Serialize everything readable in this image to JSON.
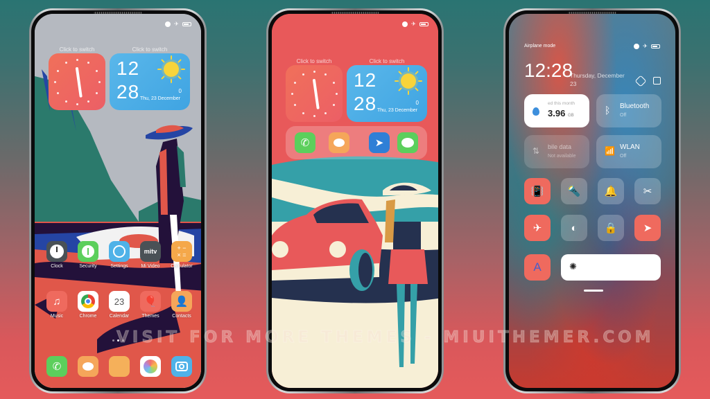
{
  "colors": {
    "accent_red": "#ec5f5c",
    "weather_blue": "#4aaee6",
    "clock_red": "#ef6a5e",
    "bg_teal": "#2a7472",
    "bg_red": "#e55a5b"
  },
  "status_bar": {
    "icons": [
      "alarm-icon",
      "airplane-icon",
      "battery-icon"
    ]
  },
  "widgets": {
    "clock_switch_label": "Click to switch",
    "weather_switch_label": "Click to switch",
    "weather": {
      "hour": "12",
      "minute": "28",
      "date": "Thu, 23 December",
      "temperature": "0",
      "condition_icon": "sun-icon"
    }
  },
  "phone1": {
    "apps_row1": [
      {
        "label": "Clock",
        "icon": "clock-icon",
        "color": "#4a5156"
      },
      {
        "label": "Security",
        "icon": "security-icon",
        "color": "#5ccf5c"
      },
      {
        "label": "Settings",
        "icon": "settings-icon",
        "color": "#4fb2e8"
      },
      {
        "label": "Mi Video",
        "icon": "mitv-icon",
        "color": "#4a5156",
        "glyph": "mitv"
      },
      {
        "label": "Calculator",
        "icon": "calculator-icon",
        "color": "#f5a84a"
      }
    ],
    "apps_row2": [
      {
        "label": "Music",
        "icon": "music-icon",
        "color": "#ef6a5e"
      },
      {
        "label": "Chrome",
        "icon": "chrome-icon",
        "color": "#ffffff"
      },
      {
        "label": "Calendar",
        "icon": "calendar-icon",
        "color": "#ffffff",
        "glyph": "23"
      },
      {
        "label": "Themes",
        "icon": "themes-icon",
        "color": "#ef6a5e"
      },
      {
        "label": "Contacts",
        "icon": "contacts-icon",
        "color": "#f5a65a"
      }
    ],
    "dock": [
      {
        "name": "phone",
        "icon": "phone-icon",
        "color": "#5ccf5c"
      },
      {
        "name": "messages",
        "icon": "messages-icon",
        "color": "#f5a65a"
      },
      {
        "name": "notes",
        "icon": "notes-icon",
        "color": "#f5b05a"
      },
      {
        "name": "gallery",
        "icon": "gallery-icon",
        "color": "#ffffff"
      },
      {
        "name": "camera",
        "icon": "camera-icon",
        "color": "#4fb2e8"
      }
    ]
  },
  "phone2": {
    "dock": [
      {
        "name": "phone",
        "icon": "phone-icon",
        "color": "#5ccf5c"
      },
      {
        "name": "messages",
        "icon": "messages-icon",
        "color": "#f5a65a"
      },
      {
        "name": "mail",
        "icon": "paper-plane-icon",
        "color": "#2f7fd6"
      },
      {
        "name": "wechat",
        "icon": "wechat-icon",
        "color": "#5ccf5c"
      }
    ]
  },
  "control_center": {
    "mode_label": "Airplane mode",
    "time": "12:28",
    "date": "Thursday, December 23",
    "data_tile": {
      "label": "ed this month",
      "value": "3.96",
      "unit": "GB"
    },
    "bluetooth_tile": {
      "label": "Bluetooth",
      "state": "Off"
    },
    "mobile_data_tile": {
      "label": "bile data",
      "state": "Not available"
    },
    "wlan_tile": {
      "label": "WLAN",
      "state": "Off"
    },
    "toggles": [
      {
        "name": "vibrate",
        "icon": "vibrate-icon",
        "active": true
      },
      {
        "name": "flashlight",
        "icon": "flashlight-icon",
        "active": false
      },
      {
        "name": "mute",
        "icon": "bell-icon",
        "active": false
      },
      {
        "name": "screenshot",
        "icon": "screenshot-icon",
        "active": false
      },
      {
        "name": "airplane",
        "icon": "airplane-icon",
        "active": true
      },
      {
        "name": "dark-mode",
        "icon": "dark-mode-icon",
        "active": false
      },
      {
        "name": "lock-rotation",
        "icon": "lock-icon",
        "active": false
      },
      {
        "name": "location",
        "icon": "location-icon",
        "active": true
      }
    ],
    "auto_brightness_label": "A",
    "brightness_level": 0
  },
  "watermark": "VISIT FOR MORE THEMES - MIUITHEMER.COM"
}
